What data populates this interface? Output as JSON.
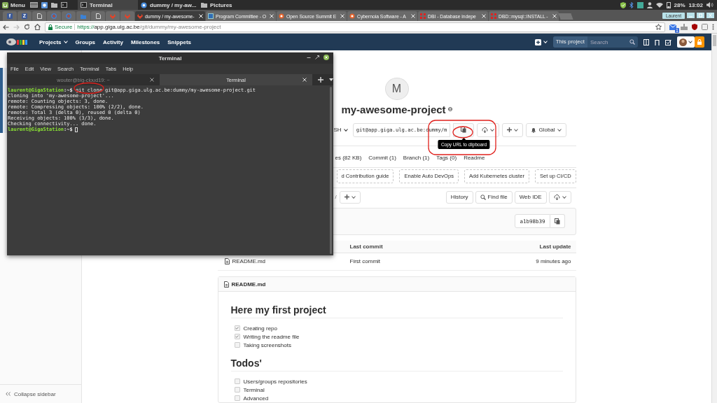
{
  "os_panel": {
    "menu_label": "Menu",
    "tasks": [
      {
        "kind": "terminal",
        "label": "Terminal",
        "selected": true
      },
      {
        "kind": "browser",
        "label": "dummy / my-aw...",
        "selected": false
      },
      {
        "kind": "folder",
        "label": "Pictures",
        "selected": false
      }
    ],
    "battery": "28%",
    "clock": "13:02"
  },
  "browser": {
    "tabs": [
      {
        "kind": "letter",
        "glyph": "f",
        "selected": false
      },
      {
        "kind": "letter",
        "glyph": "Z",
        "selected": false
      },
      {
        "kind": "page",
        "selected": false
      },
      {
        "kind": "target",
        "selected": false
      },
      {
        "kind": "target",
        "selected": false
      },
      {
        "kind": "folder",
        "selected": false
      },
      {
        "kind": "page",
        "selected": false
      },
      {
        "kind": "fox",
        "selected": false
      },
      {
        "kind": "fox",
        "selected": false
      },
      {
        "kind": "fox",
        "title": "dummy / my-awesome-",
        "selected": true
      },
      {
        "kind": "square",
        "title": "Program Committee - O",
        "selected": false
      },
      {
        "kind": "circle",
        "title": "Open Source Summit E",
        "selected": false
      },
      {
        "kind": "circle",
        "title": "Cybernoia Software - A",
        "selected": false
      },
      {
        "kind": "grid",
        "title": "DBI - Database indepe",
        "selected": false
      },
      {
        "kind": "grid",
        "title": "DBD::mysql::INSTALL -",
        "selected": false
      }
    ],
    "profile": "Laurent",
    "address": {
      "secure_label": "Secure",
      "scheme": "https://",
      "host": "app.giga.ulg.ac.be",
      "path": "/git/dummy/my-awesome-project"
    },
    "extension_badge": "1"
  },
  "navbar": {
    "items": [
      {
        "label": "Projects",
        "dropdown": true
      },
      {
        "label": "Groups",
        "dropdown": false
      },
      {
        "label": "Activity",
        "dropdown": false
      },
      {
        "label": "Milestones",
        "dropdown": false
      },
      {
        "label": "Snippets",
        "dropdown": false
      }
    ],
    "search_scope": "This project",
    "search_placeholder": "Search"
  },
  "sidebar": {
    "collapse_label": "Collapse sidebar"
  },
  "project": {
    "avatar_letter": "M",
    "name": "my-awesome-project",
    "clone": {
      "protocol": "SH",
      "url": "git@app.giga.ulg.ac.be:dummy/m",
      "tooltip": "Copy URL to clipboard"
    },
    "notification": "Global",
    "stats": [
      "es (82 KB)",
      "Commit (1)",
      "Branch (1)",
      "Tags (0)",
      "Readme"
    ],
    "quick_actions": [
      "d Contribution guide",
      "Enable Auto DevOps",
      "Add Kubernetes cluster",
      "Set up CI/CD"
    ],
    "tree": {
      "separator": "/",
      "buttons": [
        {
          "kind": "text",
          "label": "History"
        },
        {
          "kind": "search",
          "label": "Find file"
        },
        {
          "kind": "text",
          "label": "Web IDE"
        },
        {
          "kind": "download"
        }
      ]
    },
    "commit": {
      "sha": "a1b98b39"
    },
    "files": {
      "columns": [
        "Last commit",
        "Last update"
      ],
      "rows": [
        {
          "name": "README.md",
          "commit": "First commit",
          "updated": "9 minutes ago"
        }
      ]
    },
    "readme": {
      "filename": "README.md",
      "sections": [
        {
          "heading": "Here my first project",
          "tasks": [
            {
              "label": "Creating repo",
              "checked": true
            },
            {
              "label": "Writing the readme file",
              "checked": true
            },
            {
              "label": "Taking screenshots",
              "checked": false
            }
          ]
        },
        {
          "heading": "Todos'",
          "tasks": [
            {
              "label": "Users/groups repositories",
              "checked": false
            },
            {
              "label": "Terminal",
              "checked": false
            },
            {
              "label": "Advanced",
              "checked": false
            }
          ]
        }
      ]
    }
  },
  "terminal": {
    "title": "Terminal",
    "menu": [
      "File",
      "Edit",
      "View",
      "Search",
      "Terminal",
      "Tabs",
      "Help"
    ],
    "tabs": [
      {
        "label": "wouter@big-cloud19: ~",
        "selected": false
      },
      {
        "label": "Terminal",
        "selected": true
      }
    ],
    "lines": [
      {
        "kind": "command",
        "user": "laurent@GigaStation",
        "path": ":~$",
        "text": "git clone git@app.giga.ulg.ac.be:dummy/my-awesome-project.git"
      },
      {
        "kind": "output",
        "text": "Cloning into 'my-awesome-project'..."
      },
      {
        "kind": "output",
        "text": "remote: Counting objects: 3, done."
      },
      {
        "kind": "output",
        "text": "remote: Compressing objects: 100% (2/2), done."
      },
      {
        "kind": "output",
        "text": "remote: Total 3 (delta 0), reused 0 (delta 0)"
      },
      {
        "kind": "output",
        "text": "Receiving objects: 100% (3/3), done."
      },
      {
        "kind": "output",
        "text": "Checking connectivity... done."
      },
      {
        "kind": "prompt",
        "user": "laurent@GigaStation",
        "path": ":~$"
      }
    ]
  }
}
